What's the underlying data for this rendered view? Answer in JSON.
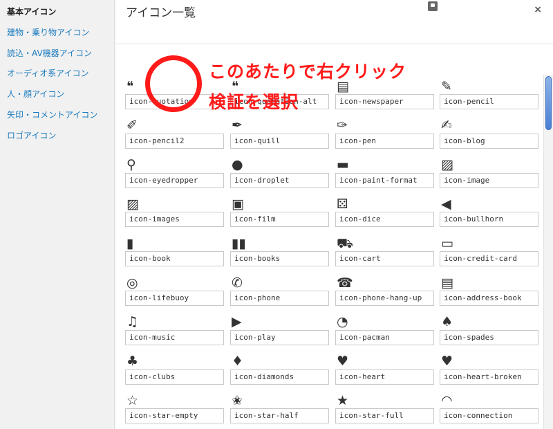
{
  "sidebar": {
    "heading": "基本アイコン",
    "items": [
      {
        "label": "建物・乗り物アイコン"
      },
      {
        "label": "読込・AV機器アイコン"
      },
      {
        "label": "オーディオ系アイコン"
      },
      {
        "label": "人・顔アイコン"
      },
      {
        "label": "矢印・コメントアイコン"
      },
      {
        "label": "ロゴアイコン"
      }
    ]
  },
  "modal": {
    "title": "アイコン一覧",
    "close": "×"
  },
  "annotation": {
    "line1": "このあたりで右クリック",
    "line2": "検証を選択"
  },
  "icons": [
    {
      "name": "icon-quotation",
      "glyph": "❝"
    },
    {
      "name": "icon-quotation-alt",
      "glyph": "❝"
    },
    {
      "name": "icon-newspaper",
      "glyph": "▤"
    },
    {
      "name": "icon-pencil",
      "glyph": "✎"
    },
    {
      "name": "icon-pencil2",
      "glyph": "✐"
    },
    {
      "name": "icon-quill",
      "glyph": "✒"
    },
    {
      "name": "icon-pen",
      "glyph": "✑"
    },
    {
      "name": "icon-blog",
      "glyph": "✍"
    },
    {
      "name": "icon-eyedropper",
      "glyph": "⚲"
    },
    {
      "name": "icon-droplet",
      "glyph": "●"
    },
    {
      "name": "icon-paint-format",
      "glyph": "▬"
    },
    {
      "name": "icon-image",
      "glyph": "▨"
    },
    {
      "name": "icon-images",
      "glyph": "▨"
    },
    {
      "name": "icon-film",
      "glyph": "▣"
    },
    {
      "name": "icon-dice",
      "glyph": "⚄"
    },
    {
      "name": "icon-bullhorn",
      "glyph": "◀"
    },
    {
      "name": "icon-book",
      "glyph": "▮"
    },
    {
      "name": "icon-books",
      "glyph": "▮▮"
    },
    {
      "name": "icon-cart",
      "glyph": "⛟"
    },
    {
      "name": "icon-credit-card",
      "glyph": "▭"
    },
    {
      "name": "icon-lifebuoy",
      "glyph": "◎"
    },
    {
      "name": "icon-phone",
      "glyph": "✆"
    },
    {
      "name": "icon-phone-hang-up",
      "glyph": "☎"
    },
    {
      "name": "icon-address-book",
      "glyph": "▤"
    },
    {
      "name": "icon-music",
      "glyph": "♫"
    },
    {
      "name": "icon-play",
      "glyph": "▶"
    },
    {
      "name": "icon-pacman",
      "glyph": "◔"
    },
    {
      "name": "icon-spades",
      "glyph": "♠"
    },
    {
      "name": "icon-clubs",
      "glyph": "♣"
    },
    {
      "name": "icon-diamonds",
      "glyph": "♦"
    },
    {
      "name": "icon-heart",
      "glyph": "♥"
    },
    {
      "name": "icon-heart-broken",
      "glyph": "♥"
    },
    {
      "name": "icon-star-empty",
      "glyph": "☆"
    },
    {
      "name": "icon-star-half",
      "glyph": "✬"
    },
    {
      "name": "icon-star-full",
      "glyph": "★"
    },
    {
      "name": "icon-connection",
      "glyph": "◠"
    }
  ]
}
